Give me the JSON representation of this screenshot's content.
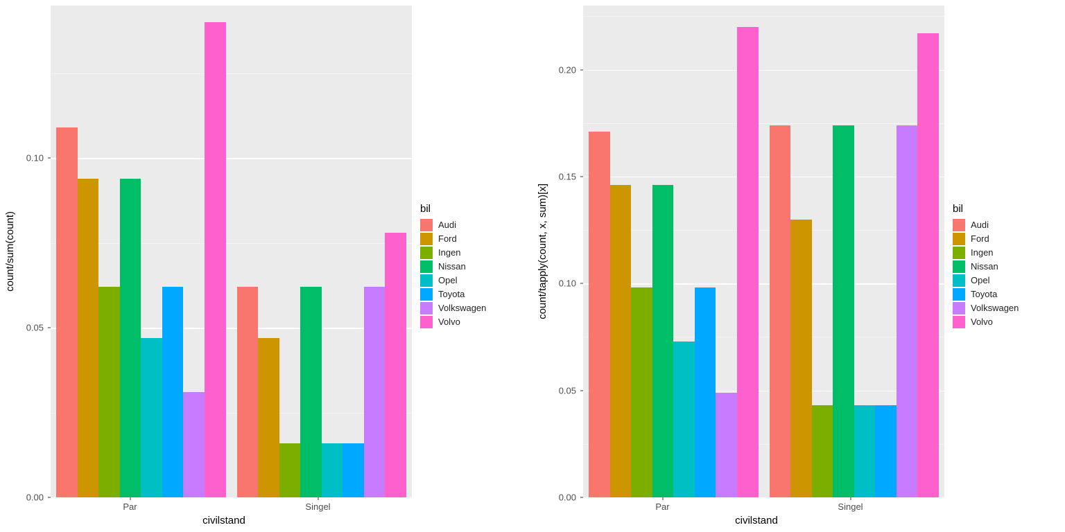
{
  "colors": {
    "Audi": "#F8766D",
    "Ford": "#CD9600",
    "Ingen": "#7CAE00",
    "Nissan": "#00BE67",
    "Opel": "#00BFC4",
    "Toyota": "#00A9FF",
    "Volkswagen": "#C77CFF",
    "Volvo": "#FF61CC"
  },
  "legend_title": "bil",
  "legend_order": [
    "Audi",
    "Ford",
    "Ingen",
    "Nissan",
    "Opel",
    "Toyota",
    "Volkswagen",
    "Volvo"
  ],
  "chart_data": [
    {
      "type": "bar",
      "title": "",
      "xlabel": "civilstand",
      "ylabel": "count/sum(count)",
      "categories": [
        "Par",
        "Singel"
      ],
      "ylim": [
        0,
        0.145
      ],
      "y_ticks": [
        0,
        0.05,
        0.1
      ],
      "y_tick_labels": [
        "0.00",
        "0.05",
        "0.10"
      ],
      "series": [
        {
          "name": "Audi",
          "values": [
            0.109,
            0.062
          ]
        },
        {
          "name": "Ford",
          "values": [
            0.094,
            0.047
          ]
        },
        {
          "name": "Ingen",
          "values": [
            0.062,
            0.016
          ]
        },
        {
          "name": "Nissan",
          "values": [
            0.094,
            0.062
          ]
        },
        {
          "name": "Opel",
          "values": [
            0.047,
            0.016
          ]
        },
        {
          "name": "Toyota",
          "values": [
            0.062,
            0.016
          ]
        },
        {
          "name": "Volkswagen",
          "values": [
            0.031,
            0.062
          ]
        },
        {
          "name": "Volvo",
          "values": [
            0.14,
            0.078
          ]
        }
      ]
    },
    {
      "type": "bar",
      "title": "",
      "xlabel": "civilstand",
      "ylabel": "count/tapply(count, x, sum)[x]",
      "categories": [
        "Par",
        "Singel"
      ],
      "ylim": [
        0,
        0.23
      ],
      "y_ticks": [
        0,
        0.05,
        0.1,
        0.15,
        0.2
      ],
      "y_tick_labels": [
        "0.00",
        "0.05",
        "0.10",
        "0.15",
        "0.20"
      ],
      "series": [
        {
          "name": "Audi",
          "values": [
            0.171,
            0.174
          ]
        },
        {
          "name": "Ford",
          "values": [
            0.146,
            0.13
          ]
        },
        {
          "name": "Ingen",
          "values": [
            0.098,
            0.043
          ]
        },
        {
          "name": "Nissan",
          "values": [
            0.146,
            0.174
          ]
        },
        {
          "name": "Opel",
          "values": [
            0.073,
            0.043
          ]
        },
        {
          "name": "Toyota",
          "values": [
            0.098,
            0.043
          ]
        },
        {
          "name": "Volkswagen",
          "values": [
            0.049,
            0.174
          ]
        },
        {
          "name": "Volvo",
          "values": [
            0.22,
            0.217
          ]
        }
      ]
    }
  ]
}
